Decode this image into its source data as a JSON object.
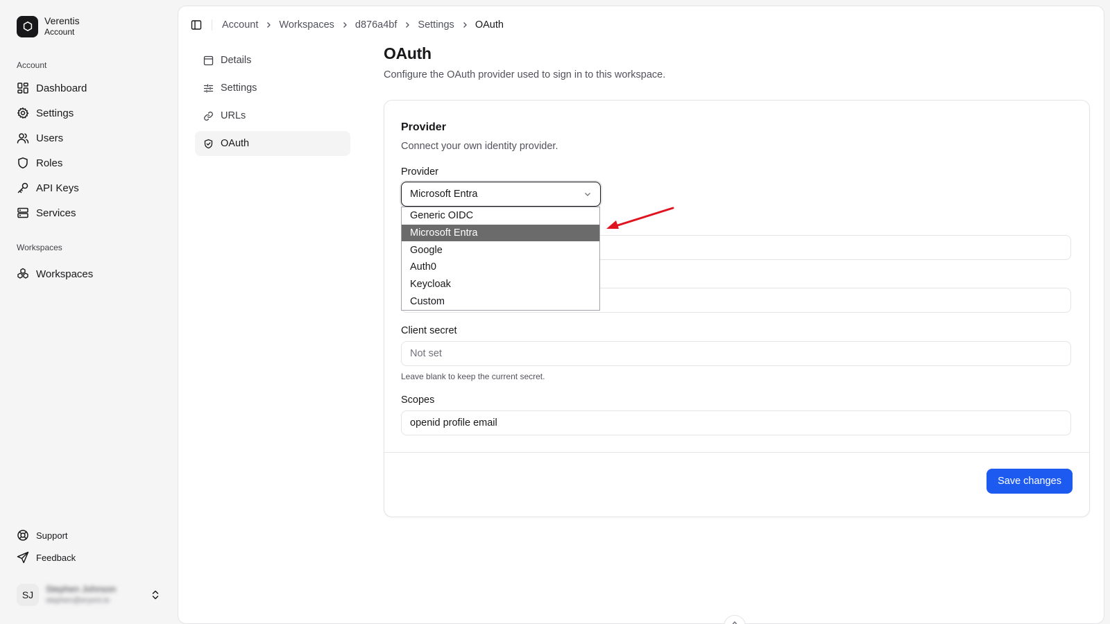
{
  "brand": {
    "name": "Verentis",
    "subtitle": "Account"
  },
  "sidebar": {
    "account_group_label": "Account",
    "account_items": [
      {
        "label": "Dashboard",
        "icon": "dashboard-icon"
      },
      {
        "label": "Settings",
        "icon": "gear-icon"
      },
      {
        "label": "Users",
        "icon": "users-icon"
      },
      {
        "label": "Roles",
        "icon": "shield-icon"
      },
      {
        "label": "API Keys",
        "icon": "key-icon"
      },
      {
        "label": "Services",
        "icon": "server-icon"
      }
    ],
    "workspaces_group_label": "Workspaces",
    "workspace_items": [
      {
        "label": "Workspaces",
        "icon": "workspaces-icon"
      }
    ],
    "footer_items": [
      {
        "label": "Support",
        "icon": "lifebuoy-icon"
      },
      {
        "label": "Feedback",
        "icon": "send-icon"
      }
    ],
    "user": {
      "initials": "SJ",
      "name": "Stephen Johnson",
      "email": "stephen@eryoni.io"
    }
  },
  "breadcrumb": [
    "Account",
    "Workspaces",
    "d876a4bf",
    "Settings",
    "OAuth"
  ],
  "subnav": [
    {
      "label": "Details",
      "icon": "details-icon",
      "active": false
    },
    {
      "label": "Settings",
      "icon": "sliders-icon",
      "active": false
    },
    {
      "label": "URLs",
      "icon": "link-icon",
      "active": false
    },
    {
      "label": "OAuth",
      "icon": "shield-check-icon",
      "active": true
    }
  ],
  "page": {
    "title": "OAuth",
    "description": "Configure the OAuth provider used to sign in to this workspace."
  },
  "card": {
    "title": "Provider",
    "description": "Connect your own identity provider.",
    "provider_label": "Provider",
    "provider_value": "Microsoft Entra",
    "provider_options": [
      "Generic OIDC",
      "Microsoft Entra",
      "Google",
      "Auth0",
      "Keycloak",
      "Custom"
    ],
    "client_secret_label": "Client secret",
    "client_secret_placeholder": "Not set",
    "client_secret_hint": "Leave blank to keep the current secret.",
    "scopes_label": "Scopes",
    "scopes_value": "openid profile email",
    "save_label": "Save changes"
  },
  "colors": {
    "accent": "#1d5bf0",
    "selected_option": "#6b6b6b",
    "annotation_arrow": "#e0141e"
  }
}
